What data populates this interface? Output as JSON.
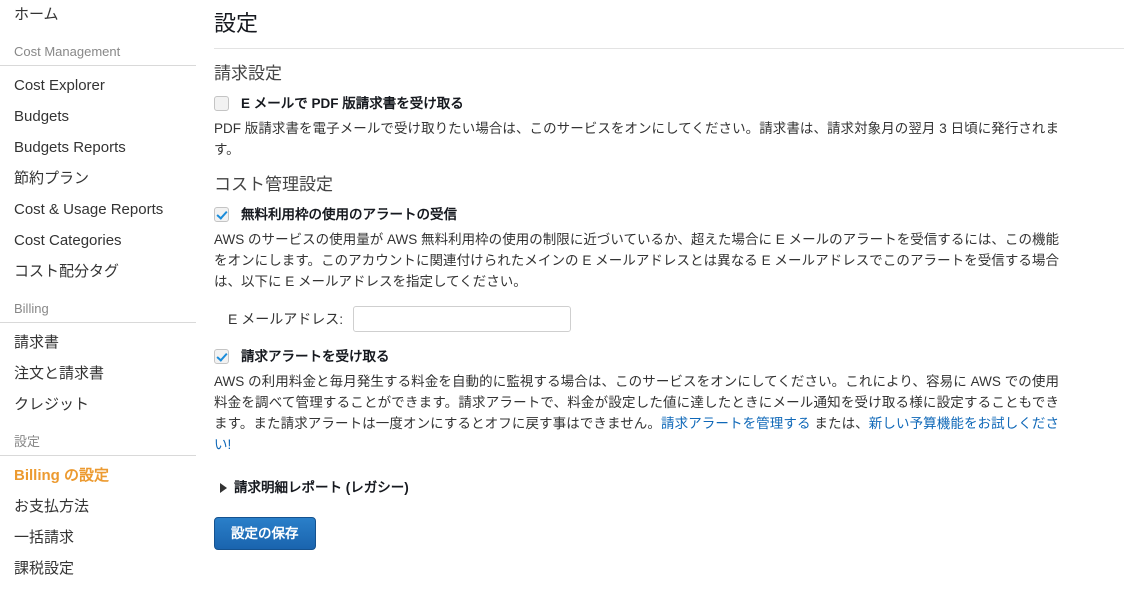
{
  "sidebar": {
    "home_label": "ホーム",
    "groups": [
      {
        "title": "Cost Management",
        "items": [
          {
            "label": "Cost Explorer",
            "active": false
          },
          {
            "label": "Budgets",
            "active": false
          },
          {
            "label": "Budgets Reports",
            "active": false
          },
          {
            "label": "節約プラン",
            "active": false
          },
          {
            "label": "Cost & Usage Reports",
            "active": false
          },
          {
            "label": "Cost Categories",
            "active": false
          },
          {
            "label": "コスト配分タグ",
            "active": false
          }
        ]
      },
      {
        "title": "Billing",
        "items": [
          {
            "label": "請求書",
            "active": false
          },
          {
            "label": "注文と請求書",
            "active": false
          },
          {
            "label": "クレジット",
            "active": false
          }
        ]
      },
      {
        "title": "設定",
        "items": [
          {
            "label": "Billing の設定",
            "active": true
          },
          {
            "label": "お支払方法",
            "active": false
          },
          {
            "label": "一括請求",
            "active": false
          },
          {
            "label": "課税設定",
            "active": false
          }
        ]
      }
    ],
    "active_color": "#ec9a30"
  },
  "main": {
    "page_title": "設定",
    "billing_section": {
      "heading": "請求設定",
      "pdf_checkbox_label": "E メールで PDF 版請求書を受け取る",
      "pdf_checked": false,
      "pdf_description": "PDF 版請求書を電子メールで受け取りたい場合は、このサービスをオンにしてください。請求書は、請求対象月の翌月 3 日頃に発行されます。"
    },
    "cost_section": {
      "heading": "コスト管理設定",
      "free_tier_checkbox_label": "無料利用枠の使用のアラートの受信",
      "free_tier_checked": true,
      "free_tier_description": "AWS のサービスの使用量が AWS 無料利用枠の使用の制限に近づいているか、超えた場合に E メールのアラートを受信するには、この機能をオンにします。このアカウントに関連付けられたメインの E メールアドレスとは異なる E メールアドレスでこのアラートを受信する場合は、以下に E メールアドレスを指定してください。",
      "email_label": "E メールアドレス:",
      "email_value": "",
      "email_placeholder": "",
      "billing_alert_checkbox_label": "請求アラートを受け取る",
      "billing_alert_checked": true,
      "billing_alert_description_part1": "AWS の利用料金と毎月発生する料金を自動的に監視する場合は、このサービスをオンにしてください。これにより、容易に AWS での使用料金を調べて管理することができます。請求アラートで、料金が設定した値に達したときにメール通知を受け取る様に設定することもできます。また請求アラートは一度オンにするとオフに戻す事はできません。",
      "billing_alert_link1": "請求アラートを管理する",
      "billing_alert_middle": " または、",
      "billing_alert_link2": "新しい予算機能をお試しください!",
      "link_color": "#0f68b8"
    },
    "legacy_report": {
      "label": "請求明細レポート (レガシー)",
      "expanded": false
    },
    "save_button_label": "設定の保存",
    "save_button_color": "#1a64ae"
  }
}
